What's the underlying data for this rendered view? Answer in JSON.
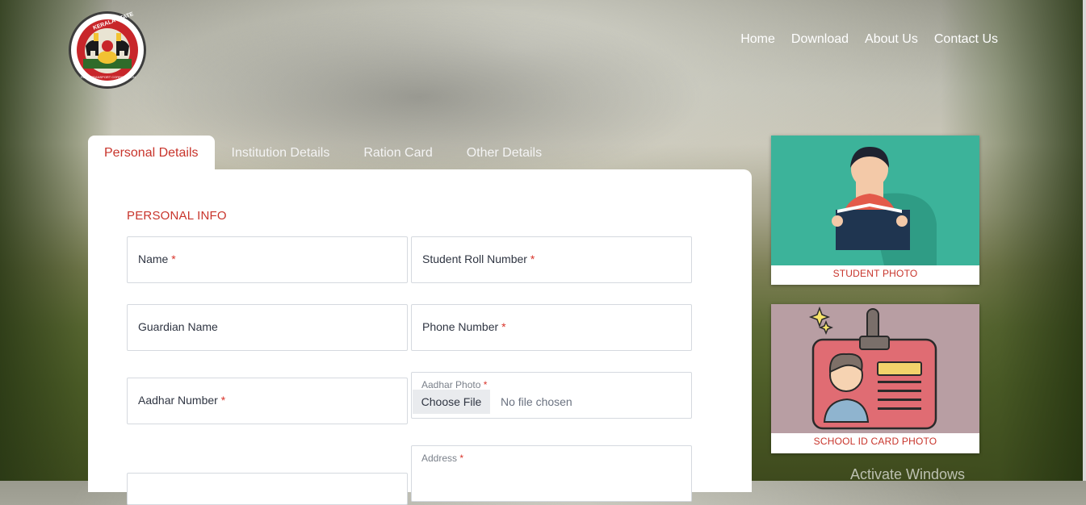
{
  "logo": {
    "text_top": "KERALA STATE",
    "text_bottom": "ROAD TRANSPORT CORPORATION"
  },
  "nav": {
    "items": [
      "Home",
      "Download",
      "About Us",
      "Contact Us"
    ]
  },
  "tabs": [
    "Personal Details",
    "Institution Details",
    "Ration Card",
    "Other Details"
  ],
  "form": {
    "section_title": "PERSONAL INFO",
    "required_mark": "*",
    "name_label": "Name",
    "roll_label": "Student Roll Number",
    "guardian_label": "Guardian Name",
    "phone_label": "Phone Number",
    "aadhar_label": "Aadhar Number",
    "aadhar_photo_label": "Aadhar Photo",
    "choose_file": "Choose File",
    "no_file": "No file chosen",
    "address_label": "Address"
  },
  "photos": {
    "student_caption": "STUDENT PHOTO",
    "id_caption": "SCHOOL ID CARD PHOTO"
  },
  "watermark": "Activate Windows",
  "colors": {
    "accent": "#c8342b",
    "teal": "#3cb39a",
    "mauve": "#b89ea3"
  }
}
